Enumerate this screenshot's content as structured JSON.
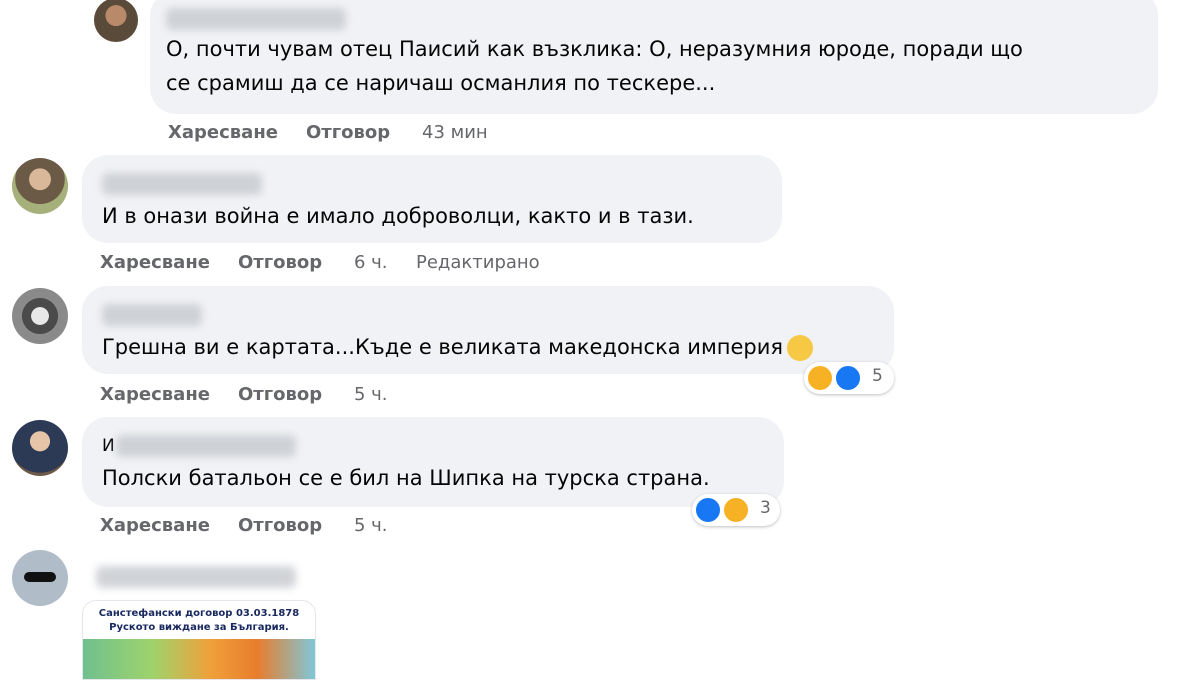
{
  "comments": [
    {
      "text": [
        "О, почти чувам отец Паисий как възклика: О, неразумния юроде, поради що",
        "се срамиш да се наричаш османлия по тескере..."
      ],
      "like": "Харесване",
      "reply": "Отговор",
      "time": "43 мин",
      "edited": ""
    },
    {
      "text": [
        "И в онази война е имало доброволци, както и в тази."
      ],
      "like": "Харесване",
      "reply": "Отговор",
      "time": "6 ч.",
      "edited": "Редактирано"
    },
    {
      "text": [
        "Грешна ви е картата...Къде е великата македонска империя"
      ],
      "like": "Харесване",
      "reply": "Отговор",
      "time": "5 ч.",
      "edited": "",
      "reactions": {
        "icons": [
          "haha",
          "like"
        ],
        "count": "5"
      }
    },
    {
      "name_initial": "И",
      "text": [
        "Полски батальон се е бил на Шипка на турска страна."
      ],
      "like": "Харесване",
      "reply": "Отговор",
      "time": "5 ч.",
      "edited": "",
      "reactions": {
        "icons": [
          "like",
          "sad"
        ],
        "count": "3"
      }
    }
  ],
  "image_post": {
    "map_title_line1": "Санстефански договор 03.03.1878",
    "map_title_line2": "Руското виждане за България."
  },
  "colors": {
    "bubble": "#f0f2f5",
    "meta": "#65676b",
    "like_blue": "#1877f2",
    "emoji_yellow": "#f7b125"
  }
}
